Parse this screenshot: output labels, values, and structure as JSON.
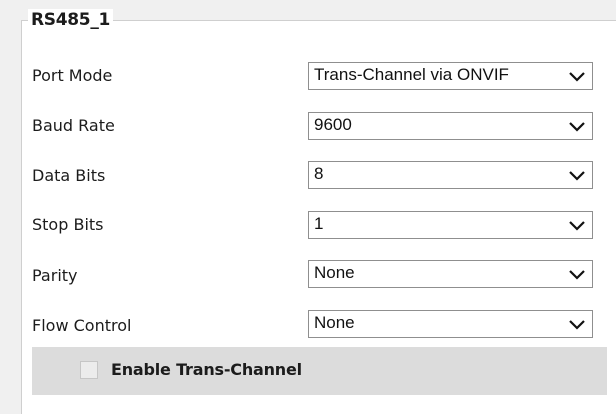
{
  "section": {
    "legend": "RS485_1"
  },
  "fields": [
    {
      "label": "Port Mode",
      "value": "Trans-Channel via ONVIF"
    },
    {
      "label": "Baud Rate",
      "value": "9600"
    },
    {
      "label": "Data Bits",
      "value": "8"
    },
    {
      "label": "Stop Bits",
      "value": "1"
    },
    {
      "label": "Parity",
      "value": "None"
    },
    {
      "label": "Flow Control",
      "value": "None"
    }
  ],
  "trans_channel": {
    "label": "Enable Trans-Channel",
    "checked": false
  },
  "icons": {
    "dropdown": "chevron-down-icon"
  },
  "colors": {
    "panel_background": "#ffffff",
    "trans_bar_background": "#dcdcdc",
    "select_border": "#8f8f8f",
    "text": "#1c1c1c"
  }
}
